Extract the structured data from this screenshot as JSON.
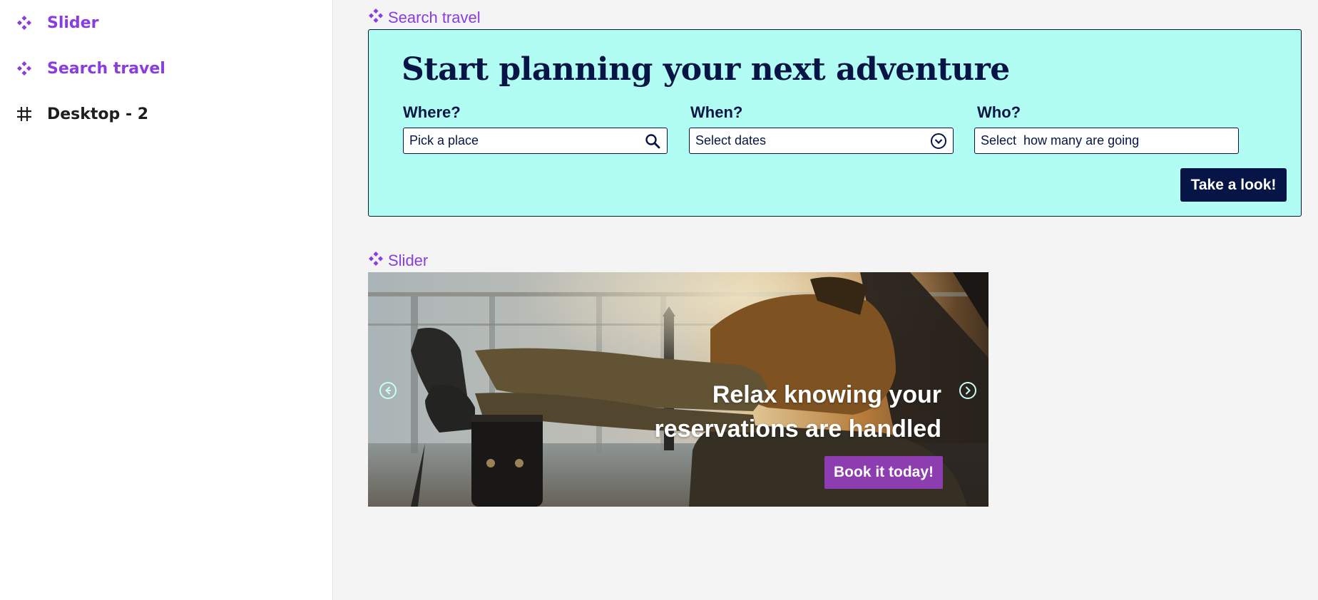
{
  "colors": {
    "accent": "#8a3ce0",
    "card_bg": "#b1fdf3",
    "navy": "#061545",
    "book_btn": "#8e3db0"
  },
  "layers": [
    {
      "label": "Slider",
      "icon": "component-icon"
    },
    {
      "label": "Search travel",
      "icon": "component-icon"
    },
    {
      "label": "Desktop - 2",
      "icon": "frame-hash-icon"
    }
  ],
  "canvas": {
    "search_tag": "Search travel",
    "slider_tag": "Slider"
  },
  "search": {
    "title": "Start planning your next adventure",
    "where_label": "Where?",
    "where_placeholder": "Pick a place",
    "when_label": "When?",
    "when_placeholder": "Select dates",
    "who_label": "Who?",
    "who_placeholder": "Select  how many are going",
    "submit_label": "Take a look!"
  },
  "slider": {
    "headline_line1": "Relax knowing your",
    "headline_line2": "reservations are handled",
    "cta_label": "Book it today!"
  }
}
